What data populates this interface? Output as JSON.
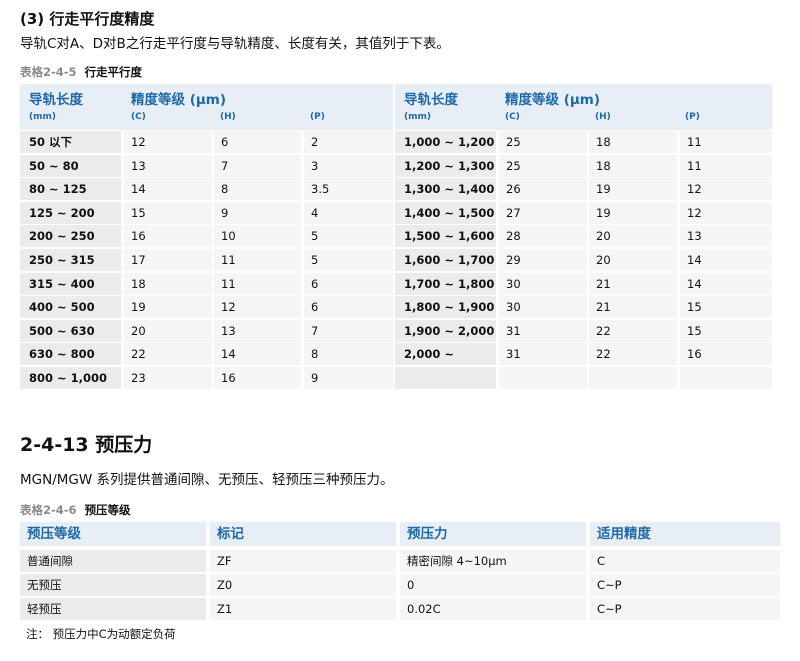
{
  "section3": {
    "heading": "(3) 行走平行度精度",
    "intro": "导轨C对A、D对B之行走平行度与导轨精度、长度有关，其值列于下表。"
  },
  "table1": {
    "number": "表格2-4-5",
    "title": "行走平行度",
    "head": {
      "length_label": "导轨长度",
      "length_unit": "(mm)",
      "grade_label": "精度等级 (μm)",
      "grades": [
        "(C)",
        "(H)",
        "(P)"
      ]
    },
    "left_rows": [
      [
        "50 以下",
        "12",
        "6",
        "2"
      ],
      [
        "50 ~ 80",
        "13",
        "7",
        "3"
      ],
      [
        "80 ~ 125",
        "14",
        "8",
        "3.5"
      ],
      [
        "125 ~ 200",
        "15",
        "9",
        "4"
      ],
      [
        "200 ~ 250",
        "16",
        "10",
        "5"
      ],
      [
        "250 ~ 315",
        "17",
        "11",
        "5"
      ],
      [
        "315 ~ 400",
        "18",
        "11",
        "6"
      ],
      [
        "400 ~ 500",
        "19",
        "12",
        "6"
      ],
      [
        "500 ~ 630",
        "20",
        "13",
        "7"
      ],
      [
        "630 ~ 800",
        "22",
        "14",
        "8"
      ],
      [
        "800 ~ 1,000",
        "23",
        "16",
        "9"
      ]
    ],
    "right_rows": [
      [
        "1,000 ~ 1,200",
        "25",
        "18",
        "11"
      ],
      [
        "1,200 ~ 1,300",
        "25",
        "18",
        "11"
      ],
      [
        "1,300 ~ 1,400",
        "26",
        "19",
        "12"
      ],
      [
        "1,400 ~ 1,500",
        "27",
        "19",
        "12"
      ],
      [
        "1,500 ~ 1,600",
        "28",
        "20",
        "13"
      ],
      [
        "1,600 ~ 1,700",
        "29",
        "20",
        "14"
      ],
      [
        "1,700 ~ 1,800",
        "30",
        "21",
        "14"
      ],
      [
        "1,800 ~ 1,900",
        "30",
        "21",
        "15"
      ],
      [
        "1,900 ~ 2,000",
        "31",
        "22",
        "15"
      ],
      [
        "2,000 ~",
        "31",
        "22",
        "16"
      ],
      [
        "",
        "",
        "",
        ""
      ]
    ]
  },
  "section_preload": {
    "heading": "2-4-13  预压力",
    "intro": "MGN/MGW 系列提供普通间隙、无预压、轻预压三种预压力。"
  },
  "table2": {
    "number": "表格2-4-6",
    "title": "预压等级",
    "headers": [
      "预压等级",
      "标记",
      "预压力",
      "适用精度"
    ],
    "rows": [
      [
        "普通间隙",
        "ZF",
        "精密间隙 4~10μm",
        "C"
      ],
      [
        "无预压",
        "Z0",
        "0",
        "C~P"
      ],
      [
        "轻预压",
        "Z1",
        "0.02C",
        "C~P"
      ]
    ]
  },
  "note": "注： 预压力中C为动额定负荷",
  "colors": {
    "header_bg": "#e7eef6",
    "header_text": "#1f6aa6",
    "row_dark": "#ebebeb",
    "row_light": "#f5f5f5"
  }
}
